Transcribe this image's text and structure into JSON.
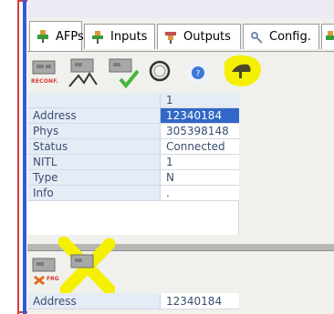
{
  "tabs": [
    {
      "label": "AFPs",
      "icon": "afp-plug-icon",
      "active": true
    },
    {
      "label": "Inputs",
      "icon": "input-plug-icon",
      "active": false
    },
    {
      "label": "Outputs",
      "icon": "output-plug-icon",
      "active": false
    },
    {
      "label": "Config.",
      "icon": "config-wrench-icon",
      "active": false
    }
  ],
  "toolbar": {
    "reconf_label": "RECONF.",
    "buttons": [
      "reconf-button",
      "route-button",
      "check-button",
      "refresh-button",
      "help-button",
      "cap-button"
    ]
  },
  "grid": {
    "column_header": "1",
    "rows": [
      {
        "label": "Address",
        "value": "12340184",
        "selected": true
      },
      {
        "label": "Phys",
        "value": "305398148",
        "selected": false
      },
      {
        "label": "Status",
        "value": "Connected",
        "selected": false
      },
      {
        "label": "NITL",
        "value": "1",
        "selected": false
      },
      {
        "label": "Type",
        "value": "N",
        "selected": false
      },
      {
        "label": "Info",
        "value": ".",
        "selected": false
      }
    ]
  },
  "lower_toolbar": {
    "frg_label": "FRG"
  },
  "lower_grid": {
    "rows": [
      {
        "label": "Address",
        "value": "12340184"
      }
    ]
  },
  "colors": {
    "selection": "#3167c6",
    "highlight": "#f4f000",
    "frame_red": "#e23a3a",
    "accent_blue": "#2f5bd4"
  }
}
